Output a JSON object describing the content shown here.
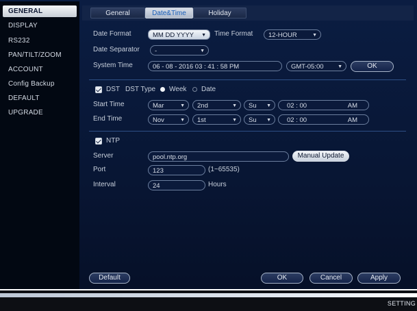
{
  "sidebar": {
    "items": [
      {
        "label": "GENERAL"
      },
      {
        "label": "DISPLAY"
      },
      {
        "label": "RS232"
      },
      {
        "label": "PAN/TILT/ZOOM"
      },
      {
        "label": "ACCOUNT"
      },
      {
        "label": "Config Backup"
      },
      {
        "label": "DEFAULT"
      },
      {
        "label": "UPGRADE"
      }
    ]
  },
  "tabs": [
    {
      "label": "General"
    },
    {
      "label": "Date&Time"
    },
    {
      "label": "Holiday"
    }
  ],
  "datetime": {
    "date_format_label": "Date Format",
    "date_format_value": "MM DD YYYY",
    "time_format_label": "Time Format",
    "time_format_value": "12-HOUR",
    "date_separator_label": "Date Separator",
    "date_separator_value": "-",
    "system_time_label": "System Time",
    "system_time_value": "06 - 08 - 2016   03 : 41 : 58 PM",
    "timezone_value": "GMT-05:00",
    "ok_label": "OK"
  },
  "dst": {
    "label": "DST",
    "type_label": "DST Type",
    "week_label": "Week",
    "date_label": "Date",
    "start_label": "Start Time",
    "end_label": "End Time",
    "start": {
      "month": "Mar",
      "week": "2nd",
      "day": "Su",
      "time": "02 : 00",
      "ampm": "AM"
    },
    "end": {
      "month": "Nov",
      "week": "1st",
      "day": "Su",
      "time": "02 : 00",
      "ampm": "AM"
    }
  },
  "ntp": {
    "label": "NTP",
    "server_label": "Server",
    "server_value": "pool.ntp.org",
    "manual_update_label": "Manual Update",
    "port_label": "Port",
    "port_value": "123",
    "port_range": "(1~65535)",
    "interval_label": "Interval",
    "interval_value": "24",
    "interval_unit": "Hours"
  },
  "footer": {
    "default_label": "Default",
    "ok_label": "OK",
    "cancel_label": "Cancel",
    "apply_label": "Apply"
  },
  "statusbar": {
    "text": "SETTING"
  }
}
